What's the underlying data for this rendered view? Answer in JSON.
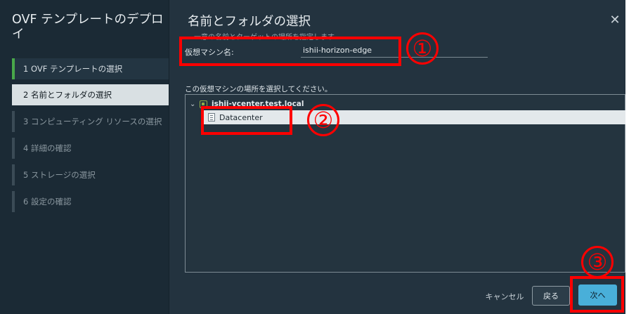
{
  "wizard": {
    "title": "OVF テンプレートのデプロイ",
    "steps": [
      {
        "label": "1  OVF テンプレートの選択",
        "state": "done"
      },
      {
        "label": "2  名前とフォルダの選択",
        "state": "active"
      },
      {
        "label": "3  コンピューティング リソースの選択",
        "state": "pending"
      },
      {
        "label": "4  詳細の確認",
        "state": "pending"
      },
      {
        "label": "5  ストレージの選択",
        "state": "pending"
      },
      {
        "label": "6  設定の確認",
        "state": "pending"
      }
    ]
  },
  "main": {
    "section_title": "名前とフォルダの選択",
    "subtitle": "一意の名前とターゲットの場所を指定します",
    "vm_name_label": "仮想マシン名:",
    "vm_name_value": "ishii-horizon-edge",
    "location_label": "この仮想マシンの場所を選択してください。",
    "tree": {
      "root": "ishii-vcenter.test.local",
      "child": "Datacenter"
    }
  },
  "footer": {
    "cancel": "キャンセル",
    "back": "戻る",
    "next": "次へ"
  },
  "annotations": [
    "①",
    "②",
    "③"
  ],
  "colors": {
    "accent": "#49afd9",
    "annotation": "#ff0000",
    "done_step": "#49a84a",
    "background": "#23333f"
  },
  "icons": {
    "close": "close-icon",
    "chevron": "chevron-down-icon",
    "vcenter": "vcenter-icon",
    "datacenter": "datacenter-icon"
  }
}
